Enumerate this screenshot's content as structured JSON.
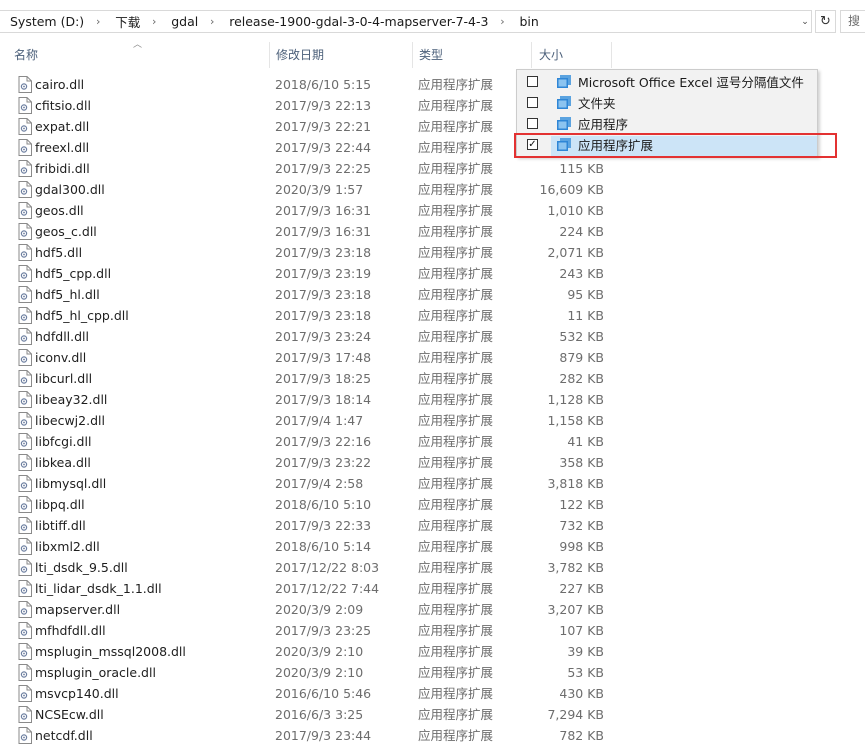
{
  "address": {
    "crumbs": [
      "System (D:)",
      "下载",
      "gdal",
      "release-1900-gdal-3-0-4-mapserver-7-4-3",
      "bin"
    ],
    "refresh_icon": "refresh-icon",
    "search_placeholder_partial": "搜"
  },
  "columns": {
    "name": "名称",
    "date": "修改日期",
    "type": "类型",
    "size": "大小"
  },
  "files": [
    {
      "name": "cairo.dll",
      "date": "2018/6/10 5:15",
      "type": "应用程序扩展",
      "size": ""
    },
    {
      "name": "cfitsio.dll",
      "date": "2017/9/3 22:13",
      "type": "应用程序扩展",
      "size": ""
    },
    {
      "name": "expat.dll",
      "date": "2017/9/3 22:21",
      "type": "应用程序扩展",
      "size": ""
    },
    {
      "name": "freexl.dll",
      "date": "2017/9/3 22:44",
      "type": "应用程序扩展",
      "size": ""
    },
    {
      "name": "fribidi.dll",
      "date": "2017/9/3 22:25",
      "type": "应用程序扩展",
      "size": "115 KB"
    },
    {
      "name": "gdal300.dll",
      "date": "2020/3/9 1:57",
      "type": "应用程序扩展",
      "size": "16,609 KB"
    },
    {
      "name": "geos.dll",
      "date": "2017/9/3 16:31",
      "type": "应用程序扩展",
      "size": "1,010 KB"
    },
    {
      "name": "geos_c.dll",
      "date": "2017/9/3 16:31",
      "type": "应用程序扩展",
      "size": "224 KB"
    },
    {
      "name": "hdf5.dll",
      "date": "2017/9/3 23:18",
      "type": "应用程序扩展",
      "size": "2,071 KB"
    },
    {
      "name": "hdf5_cpp.dll",
      "date": "2017/9/3 23:19",
      "type": "应用程序扩展",
      "size": "243 KB"
    },
    {
      "name": "hdf5_hl.dll",
      "date": "2017/9/3 23:18",
      "type": "应用程序扩展",
      "size": "95 KB"
    },
    {
      "name": "hdf5_hl_cpp.dll",
      "date": "2017/9/3 23:18",
      "type": "应用程序扩展",
      "size": "11 KB"
    },
    {
      "name": "hdfdll.dll",
      "date": "2017/9/3 23:24",
      "type": "应用程序扩展",
      "size": "532 KB"
    },
    {
      "name": "iconv.dll",
      "date": "2017/9/3 17:48",
      "type": "应用程序扩展",
      "size": "879 KB"
    },
    {
      "name": "libcurl.dll",
      "date": "2017/9/3 18:25",
      "type": "应用程序扩展",
      "size": "282 KB"
    },
    {
      "name": "libeay32.dll",
      "date": "2017/9/3 18:14",
      "type": "应用程序扩展",
      "size": "1,128 KB"
    },
    {
      "name": "libecwj2.dll",
      "date": "2017/9/4 1:47",
      "type": "应用程序扩展",
      "size": "1,158 KB"
    },
    {
      "name": "libfcgi.dll",
      "date": "2017/9/3 22:16",
      "type": "应用程序扩展",
      "size": "41 KB"
    },
    {
      "name": "libkea.dll",
      "date": "2017/9/3 23:22",
      "type": "应用程序扩展",
      "size": "358 KB"
    },
    {
      "name": "libmysql.dll",
      "date": "2017/9/4 2:58",
      "type": "应用程序扩展",
      "size": "3,818 KB"
    },
    {
      "name": "libpq.dll",
      "date": "2018/6/10 5:10",
      "type": "应用程序扩展",
      "size": "122 KB"
    },
    {
      "name": "libtiff.dll",
      "date": "2017/9/3 22:33",
      "type": "应用程序扩展",
      "size": "732 KB"
    },
    {
      "name": "libxml2.dll",
      "date": "2018/6/10 5:14",
      "type": "应用程序扩展",
      "size": "998 KB"
    },
    {
      "name": "lti_dsdk_9.5.dll",
      "date": "2017/12/22 8:03",
      "type": "应用程序扩展",
      "size": "3,782 KB"
    },
    {
      "name": "lti_lidar_dsdk_1.1.dll",
      "date": "2017/12/22 7:44",
      "type": "应用程序扩展",
      "size": "227 KB"
    },
    {
      "name": "mapserver.dll",
      "date": "2020/3/9 2:09",
      "type": "应用程序扩展",
      "size": "3,207 KB"
    },
    {
      "name": "mfhdfdll.dll",
      "date": "2017/9/3 23:25",
      "type": "应用程序扩展",
      "size": "107 KB"
    },
    {
      "name": "msplugin_mssql2008.dll",
      "date": "2020/3/9 2:10",
      "type": "应用程序扩展",
      "size": "39 KB"
    },
    {
      "name": "msplugin_oracle.dll",
      "date": "2020/3/9 2:10",
      "type": "应用程序扩展",
      "size": "53 KB"
    },
    {
      "name": "msvcp140.dll",
      "date": "2016/6/10 5:46",
      "type": "应用程序扩展",
      "size": "430 KB"
    },
    {
      "name": "NCSEcw.dll",
      "date": "2016/6/3 3:25",
      "type": "应用程序扩展",
      "size": "7,294 KB"
    },
    {
      "name": "netcdf.dll",
      "date": "2017/9/3 23:44",
      "type": "应用程序扩展",
      "size": "782 KB"
    }
  ],
  "type_filter": {
    "options": [
      {
        "label": "Microsoft Office Excel 逗号分隔值文件",
        "checked": false
      },
      {
        "label": "文件夹",
        "checked": false
      },
      {
        "label": "应用程序",
        "checked": false
      },
      {
        "label": "应用程序扩展",
        "checked": true
      }
    ],
    "highlight_color": "#e33232",
    "selected_bg": "#cce4f7"
  }
}
